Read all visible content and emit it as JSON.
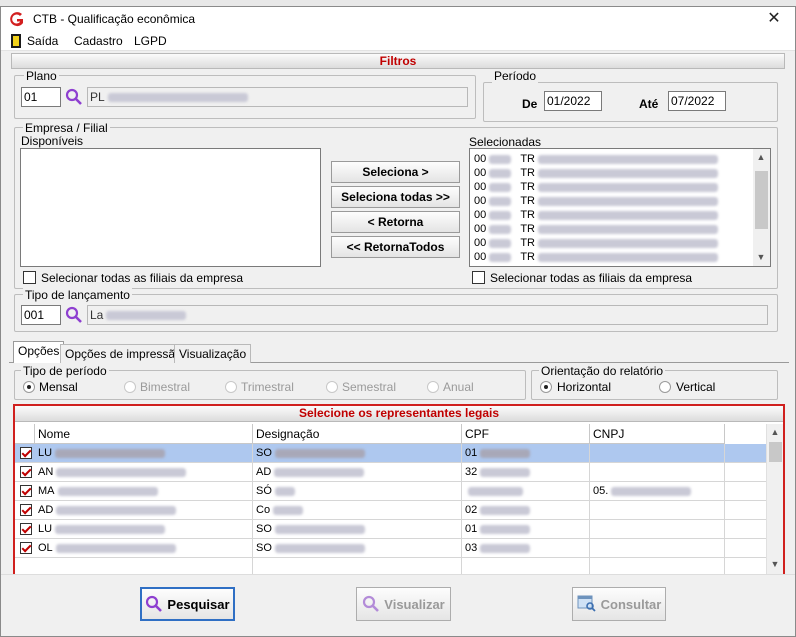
{
  "window": {
    "title": "CTB - Qualificação econômica",
    "close": "✕"
  },
  "menu": [
    "Saída",
    "Cadastro",
    "LGPD"
  ],
  "filters": {
    "header": "Filtros",
    "plano": {
      "label": "Plano",
      "code": "01",
      "desc": "PL"
    },
    "periodo": {
      "label": "Período",
      "de_label": "De",
      "de_value": "01/2022",
      "ate_label": "Até",
      "ate_value": "07/2022"
    },
    "empresa": {
      "label": "Empresa / Filial",
      "disponiveis_label": "Disponíveis",
      "selecionadas_label": "Selecionadas",
      "selecionadas": [
        {
          "code": "00",
          "name": "TR"
        },
        {
          "code": "00",
          "name": "TR"
        },
        {
          "code": "00",
          "name": "TR"
        },
        {
          "code": "00",
          "name": "TR"
        },
        {
          "code": "00",
          "name": "TR"
        },
        {
          "code": "00",
          "name": "TR"
        },
        {
          "code": "00",
          "name": "TR"
        },
        {
          "code": "00",
          "name": "TR"
        }
      ],
      "btn_seleciona": "Seleciona >",
      "btn_seleciona_todas": "Seleciona todas >>",
      "btn_retorna": "< Retorna",
      "btn_retorna_todos": "<< RetornaTodos",
      "chk_left": "Selecionar todas as filiais da empresa",
      "chk_right": "Selecionar todas as filiais da empresa"
    },
    "tipo_lancamento": {
      "label": "Tipo de  lançamento",
      "code": "001",
      "desc": "La"
    }
  },
  "tabs": [
    "Opções",
    "Opções de impressão",
    "Visualização"
  ],
  "tipo_periodo": {
    "label": "Tipo de período",
    "options": [
      "Mensal",
      "Bimestral",
      "Trimestral",
      "Semestral",
      "Anual"
    ]
  },
  "orientacao": {
    "label": "Orientação do relatório",
    "options": [
      "Horizontal",
      "Vertical"
    ]
  },
  "grid": {
    "title": "Selecione os representantes legais",
    "columns": [
      "Nome",
      "Designação",
      "CPF",
      "CNPJ"
    ],
    "rows": [
      {
        "nome": "LU",
        "designacao": "SO",
        "cpf": "01",
        "cnpj": ""
      },
      {
        "nome": "AN",
        "designacao": "AD",
        "cpf": "32",
        "cnpj": ""
      },
      {
        "nome": "MA",
        "designacao": "SÓ",
        "cpf": "",
        "cnpj": "05."
      },
      {
        "nome": "AD",
        "designacao": "Co",
        "cpf": "02",
        "cnpj": ""
      },
      {
        "nome": "LU",
        "designacao": "SO",
        "cpf": "01",
        "cnpj": ""
      },
      {
        "nome": "OL",
        "designacao": "SO",
        "cpf": "03",
        "cnpj": ""
      }
    ]
  },
  "buttons": {
    "pesquisar": "Pesquisar",
    "visualizar": "Visualizar",
    "consultar": "Consultar"
  },
  "colors": {
    "accent_red": "#c00000",
    "selection": "#aec8ef",
    "magnifier": "#8e3fd0"
  }
}
